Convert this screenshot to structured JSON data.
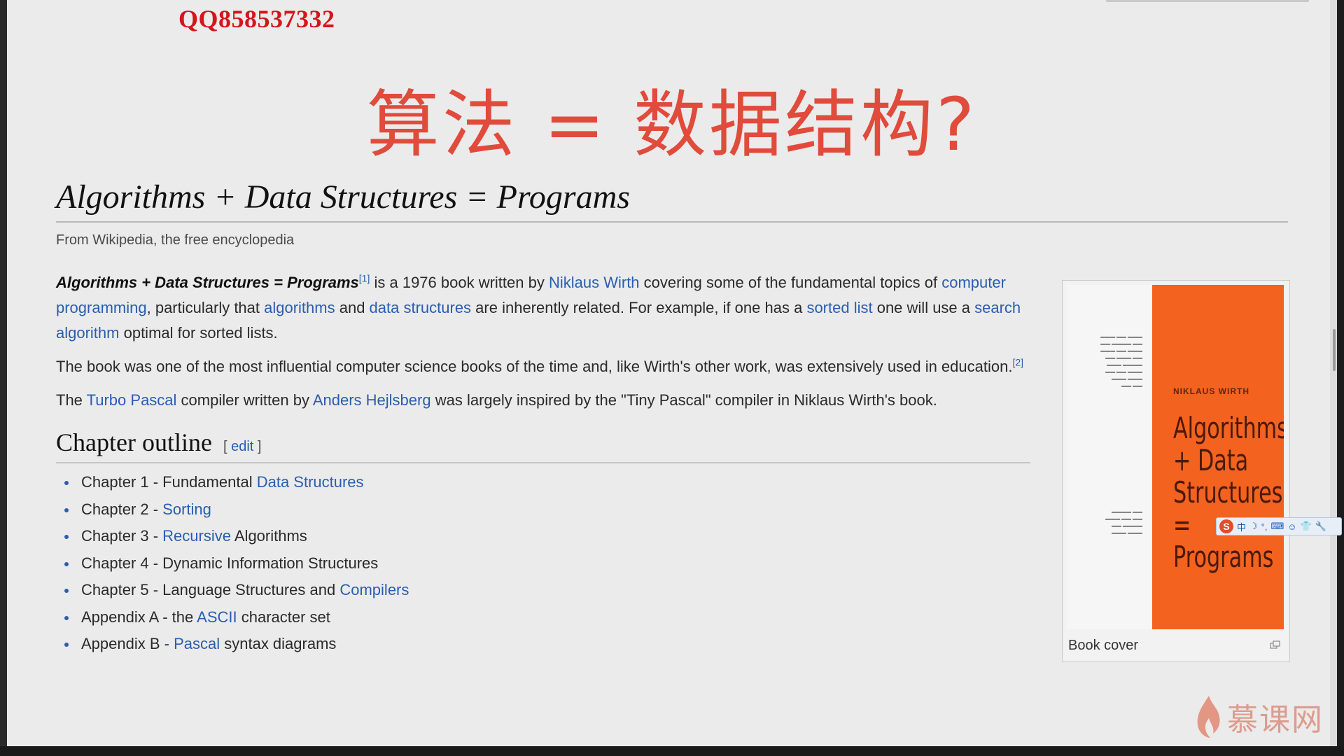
{
  "watermark": {
    "text": "QQ858537332"
  },
  "slide": {
    "heading": "算法 = 数据结构?"
  },
  "article": {
    "title": "Algorithms + Data Structures = Programs",
    "tagline": "From Wikipedia, the free encyclopedia",
    "para1": {
      "bold_title": "Algorithms + Data Structures = Programs",
      "ref1": "[1]",
      "t1": " is a 1976 book written by ",
      "link_wirth": "Niklaus Wirth",
      "t2": " covering some of the fundamental topics of ",
      "link_cp": "computer programming",
      "t3": ", particularly that ",
      "link_algorithms": "algorithms",
      "t4": " and ",
      "link_ds": "data structures",
      "t5": " are inherently related. For example, if one has a ",
      "link_sorted": "sorted list",
      "t6": " one will use a ",
      "link_search": "search algorithm",
      "t7": " optimal for sorted lists."
    },
    "para2": {
      "text": "The book was one of the most influential computer science books of the time and, like Wirth's other work, was extensively used in education.",
      "ref2": "[2]"
    },
    "para3": {
      "t1": "The ",
      "link_turbo": "Turbo Pascal",
      "t2": " compiler written by ",
      "link_anders": "Anders Hejlsberg",
      "t3": " was largely inspired by the \"Tiny Pascal\" compiler in Niklaus Wirth's book."
    },
    "section": {
      "title": "Chapter outline",
      "edit_open": "[ ",
      "edit": "edit",
      "edit_close": " ]"
    },
    "chapters": [
      {
        "pre": "Chapter 1 - Fundamental ",
        "link": "Data Structures",
        "post": ""
      },
      {
        "pre": "Chapter 2 - ",
        "link": "Sorting",
        "post": ""
      },
      {
        "pre": "Chapter 3 - ",
        "link": "Recursive",
        "post": " Algorithms"
      },
      {
        "pre": "Chapter 4 - Dynamic Information Structures",
        "link": "",
        "post": ""
      },
      {
        "pre": "Chapter 5 - Language Structures and ",
        "link": "Compilers",
        "post": ""
      },
      {
        "pre": "Appendix A - the ",
        "link": "ASCII",
        "post": " character set"
      },
      {
        "pre": "Appendix B - ",
        "link": "Pascal",
        "post": " syntax diagrams"
      }
    ]
  },
  "infobox": {
    "author": "NIKLAUS WIRTH",
    "cover_title": "Algorithms + Data Structures = Programs",
    "caption": "Book cover"
  },
  "ime": {
    "items": [
      "中",
      "☽",
      "°,",
      "⌨",
      "☺",
      "👕",
      "🔧"
    ]
  },
  "brand": {
    "imooc": "慕课网"
  },
  "colors": {
    "heading": "#e04b3c",
    "link": "#2a5db0",
    "cover": "#f3621f",
    "watermark": "#d4161b"
  }
}
